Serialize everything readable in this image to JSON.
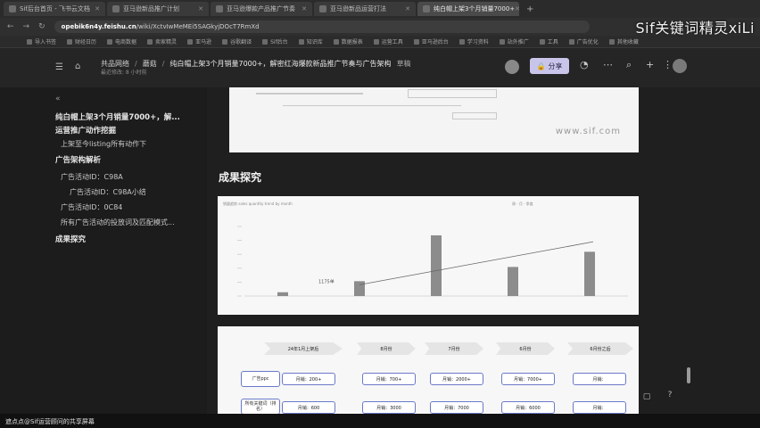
{
  "browser": {
    "tabs": [
      {
        "label": "Sif后台首页 - 飞书云文档",
        "active": false
      },
      {
        "label": "亚马逊新品推广计划",
        "active": false
      },
      {
        "label": "亚马逊爆款产品推广节奏",
        "active": false
      },
      {
        "label": "亚马逊新品运营打法",
        "active": false
      },
      {
        "label": "纯白帽上架3个月销量7000+",
        "active": true
      }
    ],
    "url_domain": "opebik6n4y.feishu.cn",
    "url_path": "/wiki/XctvIwMeMEi5SAGkyjDOcT7RmXd",
    "bookmarks": [
      "导入书签",
      "财经日历",
      "电商数据",
      "卖家精灵",
      "亚马逊",
      "谷歌翻译",
      "Sif后台",
      "知识库",
      "数据报表",
      "运营工具",
      "亚马逊后台",
      "学习资料",
      "站外推广",
      "工具",
      "广告优化",
      "其他收藏"
    ]
  },
  "overlay_brand": "Sif关键词精灵xiLi",
  "doc": {
    "breadcrumb": [
      "共品网络",
      "蘑菇"
    ],
    "title": "纯白帽上架3个月销量7000+，解密红海爆款新品推广节奏与广告架构",
    "status": "草稿",
    "subline": "最近修改: 8 小时前",
    "share_label": "分享"
  },
  "toc": [
    {
      "label": "纯白帽上架3个月销量7000+，解...",
      "level": 1
    },
    {
      "label": "运营推广动作挖掘",
      "level": 1
    },
    {
      "label": "上架至今listing所有动作下",
      "level": 2
    },
    {
      "label": "广告架构解析",
      "level": 1
    },
    {
      "label": "广告活动ID：C98A",
      "level": 2
    },
    {
      "label": "广告活动ID：C98A小结",
      "level": 3
    },
    {
      "label": "广告活动ID：0C84",
      "level": 2
    },
    {
      "label": "所有广告活动的投放词及匹配模式...",
      "level": 2
    },
    {
      "label": "成果探究",
      "level": 1
    }
  ],
  "content": {
    "watermark": "www.sif.com",
    "section_title": "成果探究",
    "chart_topline": "销量趋势 sales quantity trend by month",
    "chart_legend": "周 · 月 · 季度",
    "chart_annotation": "1175单",
    "flow_stages": [
      "24年1月上架后",
      "8月份",
      "7月份",
      "6月份",
      "6月份之后"
    ],
    "flow_row1_label": "广告ppc",
    "flow_row1": [
      "月销：200+",
      "月销：700+",
      "月销：2000+",
      "月销：7000+",
      "月销："
    ],
    "flow_row2_label": "所有关键词（排名）",
    "flow_row2": [
      "月销：600",
      "月销：3000",
      "月销：7000",
      "月销：6000",
      "月销："
    ]
  },
  "chart_data": {
    "type": "bar",
    "categories": [
      "1",
      "2",
      "3",
      "4",
      "5"
    ],
    "values": [
      300,
      1175,
      4800,
      2300,
      3500
    ],
    "ylim": [
      0,
      5500
    ],
    "trend_line": true,
    "grid": false,
    "legend": "top-right"
  },
  "bottom_text": "遮点点@Sif运营顾问的共享屏幕",
  "colors": {
    "accent": "#c9c4ea",
    "flow_border": "#6b79c9",
    "bar": "#8c8c8c"
  }
}
